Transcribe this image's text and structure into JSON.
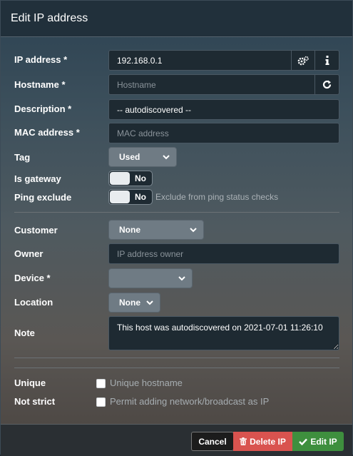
{
  "dialog": {
    "title": "Edit IP address"
  },
  "form": {
    "ip_address": {
      "label": "IP address *",
      "value": "192.168.0.1"
    },
    "hostname": {
      "label": "Hostname *",
      "placeholder": "Hostname"
    },
    "description": {
      "label": "Description *",
      "value": "-- autodiscovered --"
    },
    "mac_address": {
      "label": "MAC address *",
      "placeholder": "MAC address"
    },
    "tag": {
      "label": "Tag",
      "value": "Used"
    },
    "is_gateway": {
      "label": "Is gateway",
      "value": "No"
    },
    "ping_exclude": {
      "label": "Ping exclude",
      "value": "No",
      "hint": "Exclude from ping status checks"
    },
    "customer": {
      "label": "Customer",
      "value": "None"
    },
    "owner": {
      "label": "Owner",
      "placeholder": "IP address owner"
    },
    "device": {
      "label": "Device *",
      "value": ""
    },
    "location": {
      "label": "Location",
      "value": "None"
    },
    "note": {
      "label": "Note",
      "value": "This host was autodiscovered on 2021-07-01 11:26:10"
    },
    "unique": {
      "label": "Unique",
      "option": "Unique hostname",
      "checked": false
    },
    "not_strict": {
      "label": "Not strict",
      "option": "Permit adding network/broadcast as IP",
      "checked": false
    }
  },
  "footer": {
    "cancel": "Cancel",
    "delete": "Delete IP",
    "edit": "Edit IP"
  },
  "icons": {
    "ip_actions": "gears-icon",
    "ip_info": "info-icon",
    "hostname_refresh": "refresh-icon",
    "delete": "trash-icon",
    "edit": "check-icon"
  },
  "colors": {
    "delete_button": "#d9534f",
    "edit_button": "#3e8f3e",
    "cancel_button": "#1c1c1c"
  }
}
